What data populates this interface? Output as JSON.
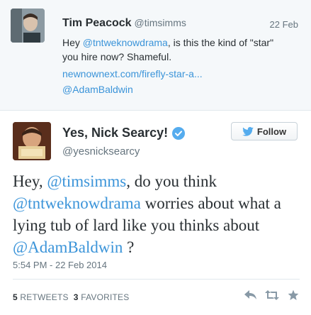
{
  "parent_tweet": {
    "name": "Tim Peacock",
    "handle": "@timsimms",
    "date": "22 Feb",
    "text_before": "Hey ",
    "text_mention": "@tntweknowdrama",
    "text_after": ", is this the kind of \"star\" you hire now? Shameful.",
    "url": "newnownext.com/firefly-star-a...",
    "mention_line": "@AdamBaldwin"
  },
  "tweet": {
    "name": "Yes, Nick Searcy!",
    "handle": "@yesnicksearcy",
    "follow_label": "Follow",
    "text": {
      "t1": "Hey, ",
      "m1": "@timsimms",
      "t2": ", do you think ",
      "m2": "@tntweknowdrama",
      "t3": " worries about what a lying tub of lard like you thinks about ",
      "m3": "@AdamBaldwin",
      "t4": " ?"
    },
    "timestamp": "5:54 PM - 22 Feb 2014",
    "retweets_count": "5",
    "retweets_label": "RETWEETS",
    "favorites_count": "3",
    "favorites_label": "FAVORITES"
  },
  "icons": {
    "verified": "verified-badge-icon",
    "follow": "twitter-bird-icon",
    "reply": "reply-icon",
    "retweet": "retweet-icon",
    "favorite": "star-icon"
  },
  "colors": {
    "link": "#3b94d9",
    "verified": "#55acee",
    "parent_bg": "#f5f8fa"
  }
}
